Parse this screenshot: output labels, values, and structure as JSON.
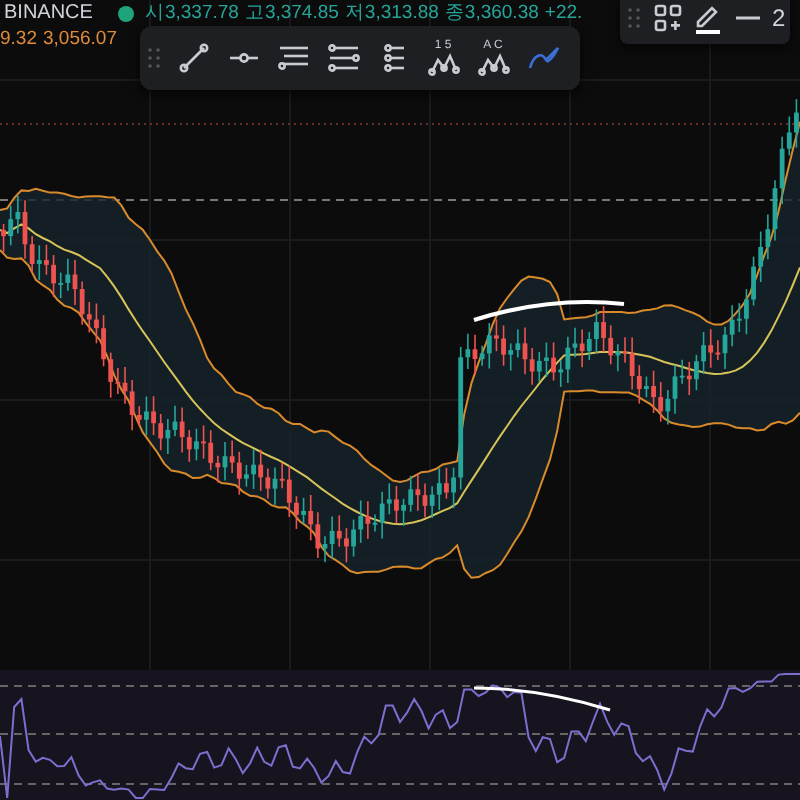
{
  "header": {
    "exchange": "BINANCE",
    "ohlc": [
      "시3,337.78",
      "고3,374.85",
      "저3,313.88",
      "종3,360.38",
      "+22."
    ],
    "indicator_values": [
      "9.32",
      "3,056.07"
    ]
  },
  "drawing_toolbar": {
    "tools": [
      {
        "kind": "trendline",
        "selected": false
      },
      {
        "kind": "hline",
        "selected": false
      },
      {
        "kind": "channel",
        "selected": false
      },
      {
        "kind": "fib",
        "selected": false
      },
      {
        "kind": "grid",
        "selected": false
      },
      {
        "kind": "pattern",
        "label": "1 5",
        "selected": false
      },
      {
        "kind": "pattern",
        "label": "A C",
        "selected": false
      },
      {
        "kind": "brush",
        "selected": true
      }
    ]
  },
  "top_toolbar": {
    "tools": [
      {
        "kind": "add"
      },
      {
        "kind": "pencil"
      },
      {
        "kind": "minus"
      }
    ],
    "value": "2"
  }
}
